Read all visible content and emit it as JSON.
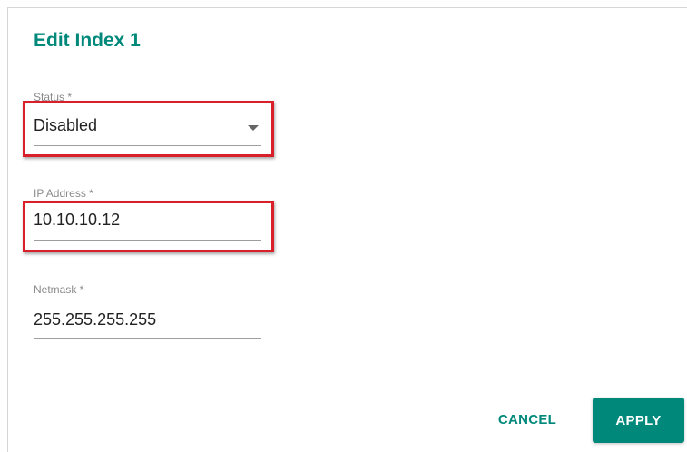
{
  "dialog": {
    "title": "Edit Index 1"
  },
  "fields": {
    "status": {
      "label": "Status *",
      "value": "Disabled"
    },
    "ip_address": {
      "label": "IP Address *",
      "value": "10.10.10.12"
    },
    "netmask": {
      "label": "Netmask *",
      "value": "255.255.255.255"
    }
  },
  "actions": {
    "cancel_label": "CANCEL",
    "apply_label": "APPLY"
  },
  "colors": {
    "accent": "#00897b",
    "highlight": "#d9202a"
  },
  "icons": {
    "status_dropdown": "chevron-down-icon"
  }
}
